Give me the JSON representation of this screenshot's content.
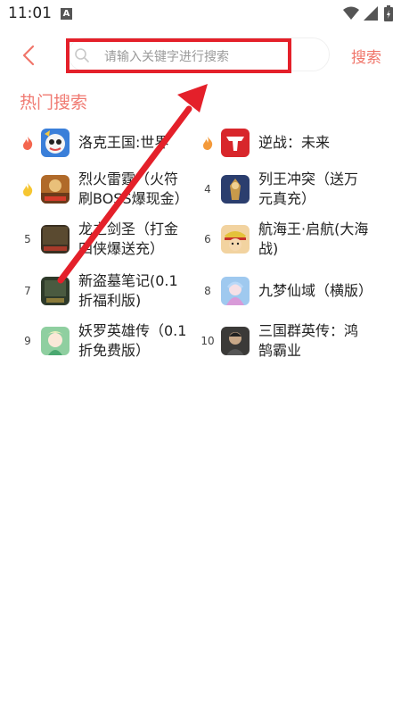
{
  "status_bar": {
    "time": "11:01",
    "notification_icon": "A"
  },
  "header": {
    "back_icon": "back-arrow-icon",
    "search_placeholder": "请输入关键字进行搜索",
    "search_button": "搜索"
  },
  "hot_search": {
    "title": "热门搜索",
    "items": [
      {
        "rank": "",
        "rank_icon": "fire-icon-red",
        "name": "洛克王国:世界",
        "thumb_color": "#3a7fd9"
      },
      {
        "rank": "",
        "rank_icon": "fire-icon-orange",
        "name": "逆战：未来",
        "thumb_color": "#d8262b"
      },
      {
        "rank": "",
        "rank_icon": "fire-icon-yellow",
        "name": "烈火雷霆（火符刷BOSS爆现金）",
        "thumb_color": "#b06a2a"
      },
      {
        "rank": "4",
        "rank_icon": "",
        "name": "列王冲突（送万元真充）",
        "thumb_color": "#2b3e6e"
      },
      {
        "rank": "5",
        "rank_icon": "",
        "name": "龙之剑圣（打金四侠爆送充）",
        "thumb_color": "#3a3022"
      },
      {
        "rank": "6",
        "rank_icon": "",
        "name": "航海王·启航(大海战)",
        "thumb_color": "#e45a3a"
      },
      {
        "rank": "7",
        "rank_icon": "",
        "name": "新盗墓笔记(0.1折福利版)",
        "thumb_color": "#2e3a2a"
      },
      {
        "rank": "8",
        "rank_icon": "",
        "name": "九梦仙域（横版）",
        "thumb_color": "#9fc9ef"
      },
      {
        "rank": "9",
        "rank_icon": "",
        "name": "妖罗英雄传（0.1折免费版）",
        "thumb_color": "#8fcfa0"
      },
      {
        "rank": "10",
        "rank_icon": "",
        "name": "三国群英传：鸿鹄霸业",
        "thumb_color": "#3b3a38"
      }
    ]
  },
  "colors": {
    "accent": "#f0756a",
    "highlight_box": "#e4202a",
    "arrow": "#e4202a"
  }
}
